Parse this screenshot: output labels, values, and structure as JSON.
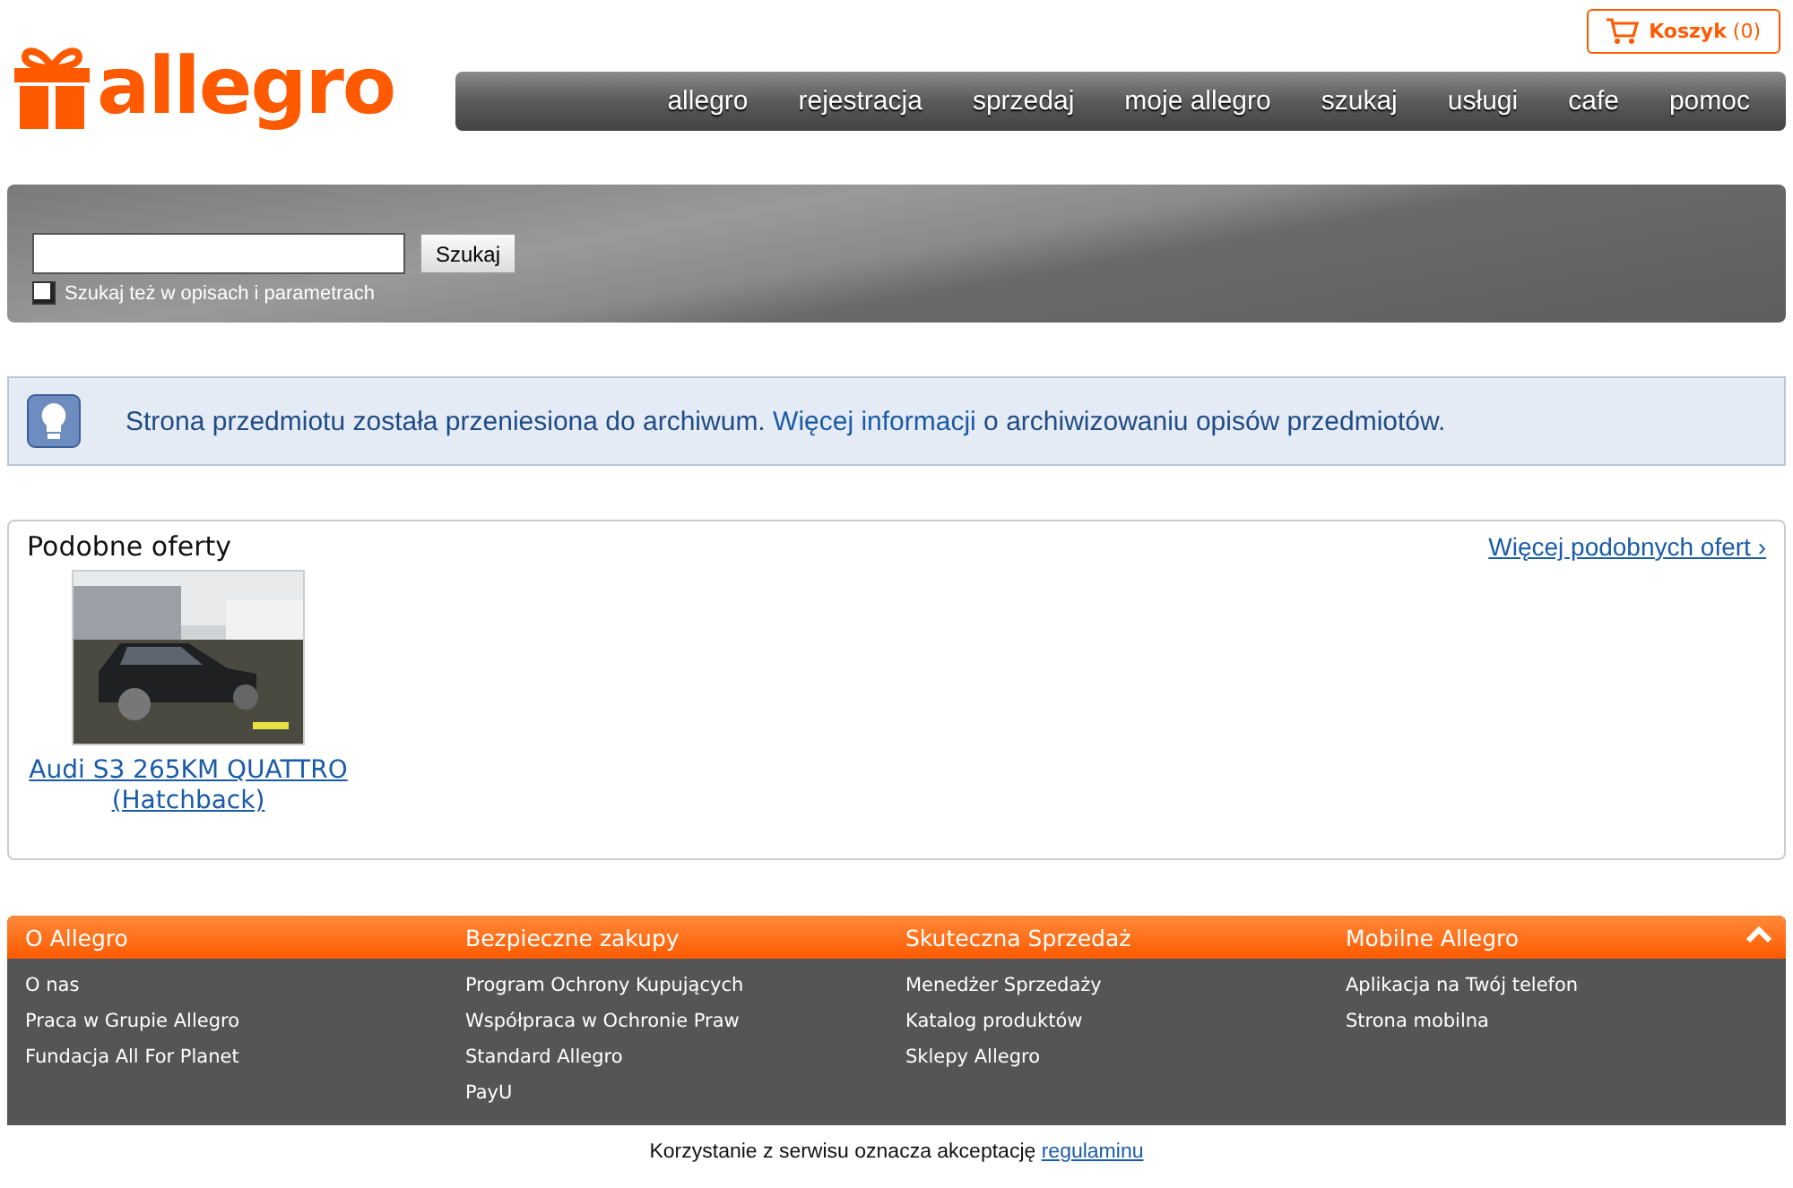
{
  "header": {
    "logo": "allegro",
    "cart": {
      "label": "Koszyk",
      "count": "(0)"
    },
    "nav": [
      "allegro",
      "rejestracja",
      "sprzedaj",
      "moje allegro",
      "szukaj",
      "usługi",
      "cafe",
      "pomoc"
    ]
  },
  "search": {
    "button": "Szukaj",
    "option": {
      "label": "Szukaj też w opisach i parametrach",
      "checked": false
    }
  },
  "notice": {
    "text_before": "Strona przedmiotu została przeniesiona do archiwum.",
    "link": "Więcej informacji",
    "text_after": "o archiwizowaniu opisów przedmiotów."
  },
  "similar_offers": {
    "title": "Podobne oferty",
    "more_link": "Więcej podobnych ofert ›",
    "items": [
      {
        "kind": "picture",
        "title": "Audi S3 265KM QUATTRO (Hatchback)"
      }
    ]
  },
  "footer": {
    "columns": [
      {
        "title": "O Allegro",
        "links": [
          "O nas",
          "Praca w Grupie Allegro",
          "Fundacja All For Planet"
        ]
      },
      {
        "title": "Bezpieczne zakupy",
        "links": [
          "Program Ochrony Kupujących",
          "Współpraca w Ochronie Praw",
          "Standard Allegro",
          "PayU"
        ]
      },
      {
        "title": "Skuteczna Sprzedaż",
        "links": [
          "Menedżer Sprzedaży",
          "Katalog produktów",
          "Sklepy Allegro"
        ]
      },
      {
        "title": "Mobilne Allegro",
        "links": [
          "Aplikacja na Twój telefon",
          "Strona mobilna"
        ]
      }
    ],
    "legal": {
      "text": "Korzystanie z serwisu oznacza akceptację",
      "link": "regulaminu"
    }
  }
}
